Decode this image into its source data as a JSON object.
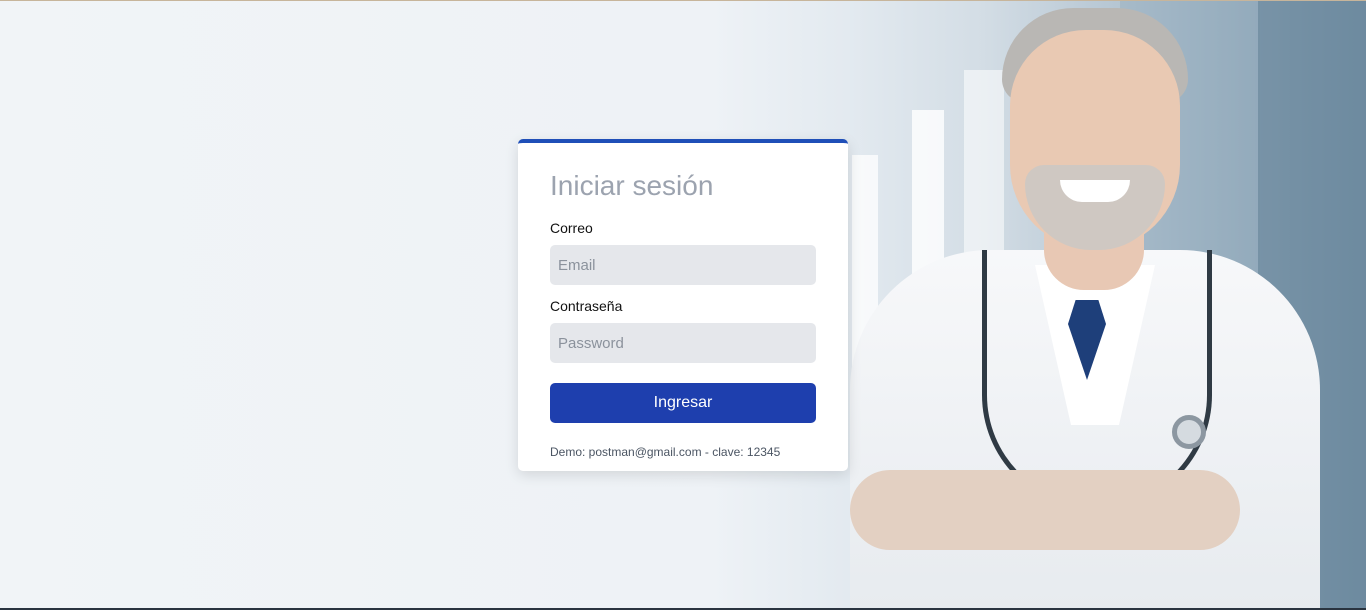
{
  "login": {
    "title": "Iniciar sesión",
    "email_label": "Correo",
    "email_placeholder": "Email",
    "email_value": "",
    "password_label": "Contraseña",
    "password_placeholder": "Password",
    "password_value": "",
    "submit_label": "Ingresar",
    "demo_note": "Demo: postman@gmail.com - clave: 12345"
  },
  "colors": {
    "accent": "#1e3fae",
    "card_top_border": "#1f4fb8",
    "input_bg": "#e5e7eb",
    "title_color": "#9ca3af"
  },
  "background": {
    "image_subject": "smiling-doctor-with-stethoscope"
  }
}
